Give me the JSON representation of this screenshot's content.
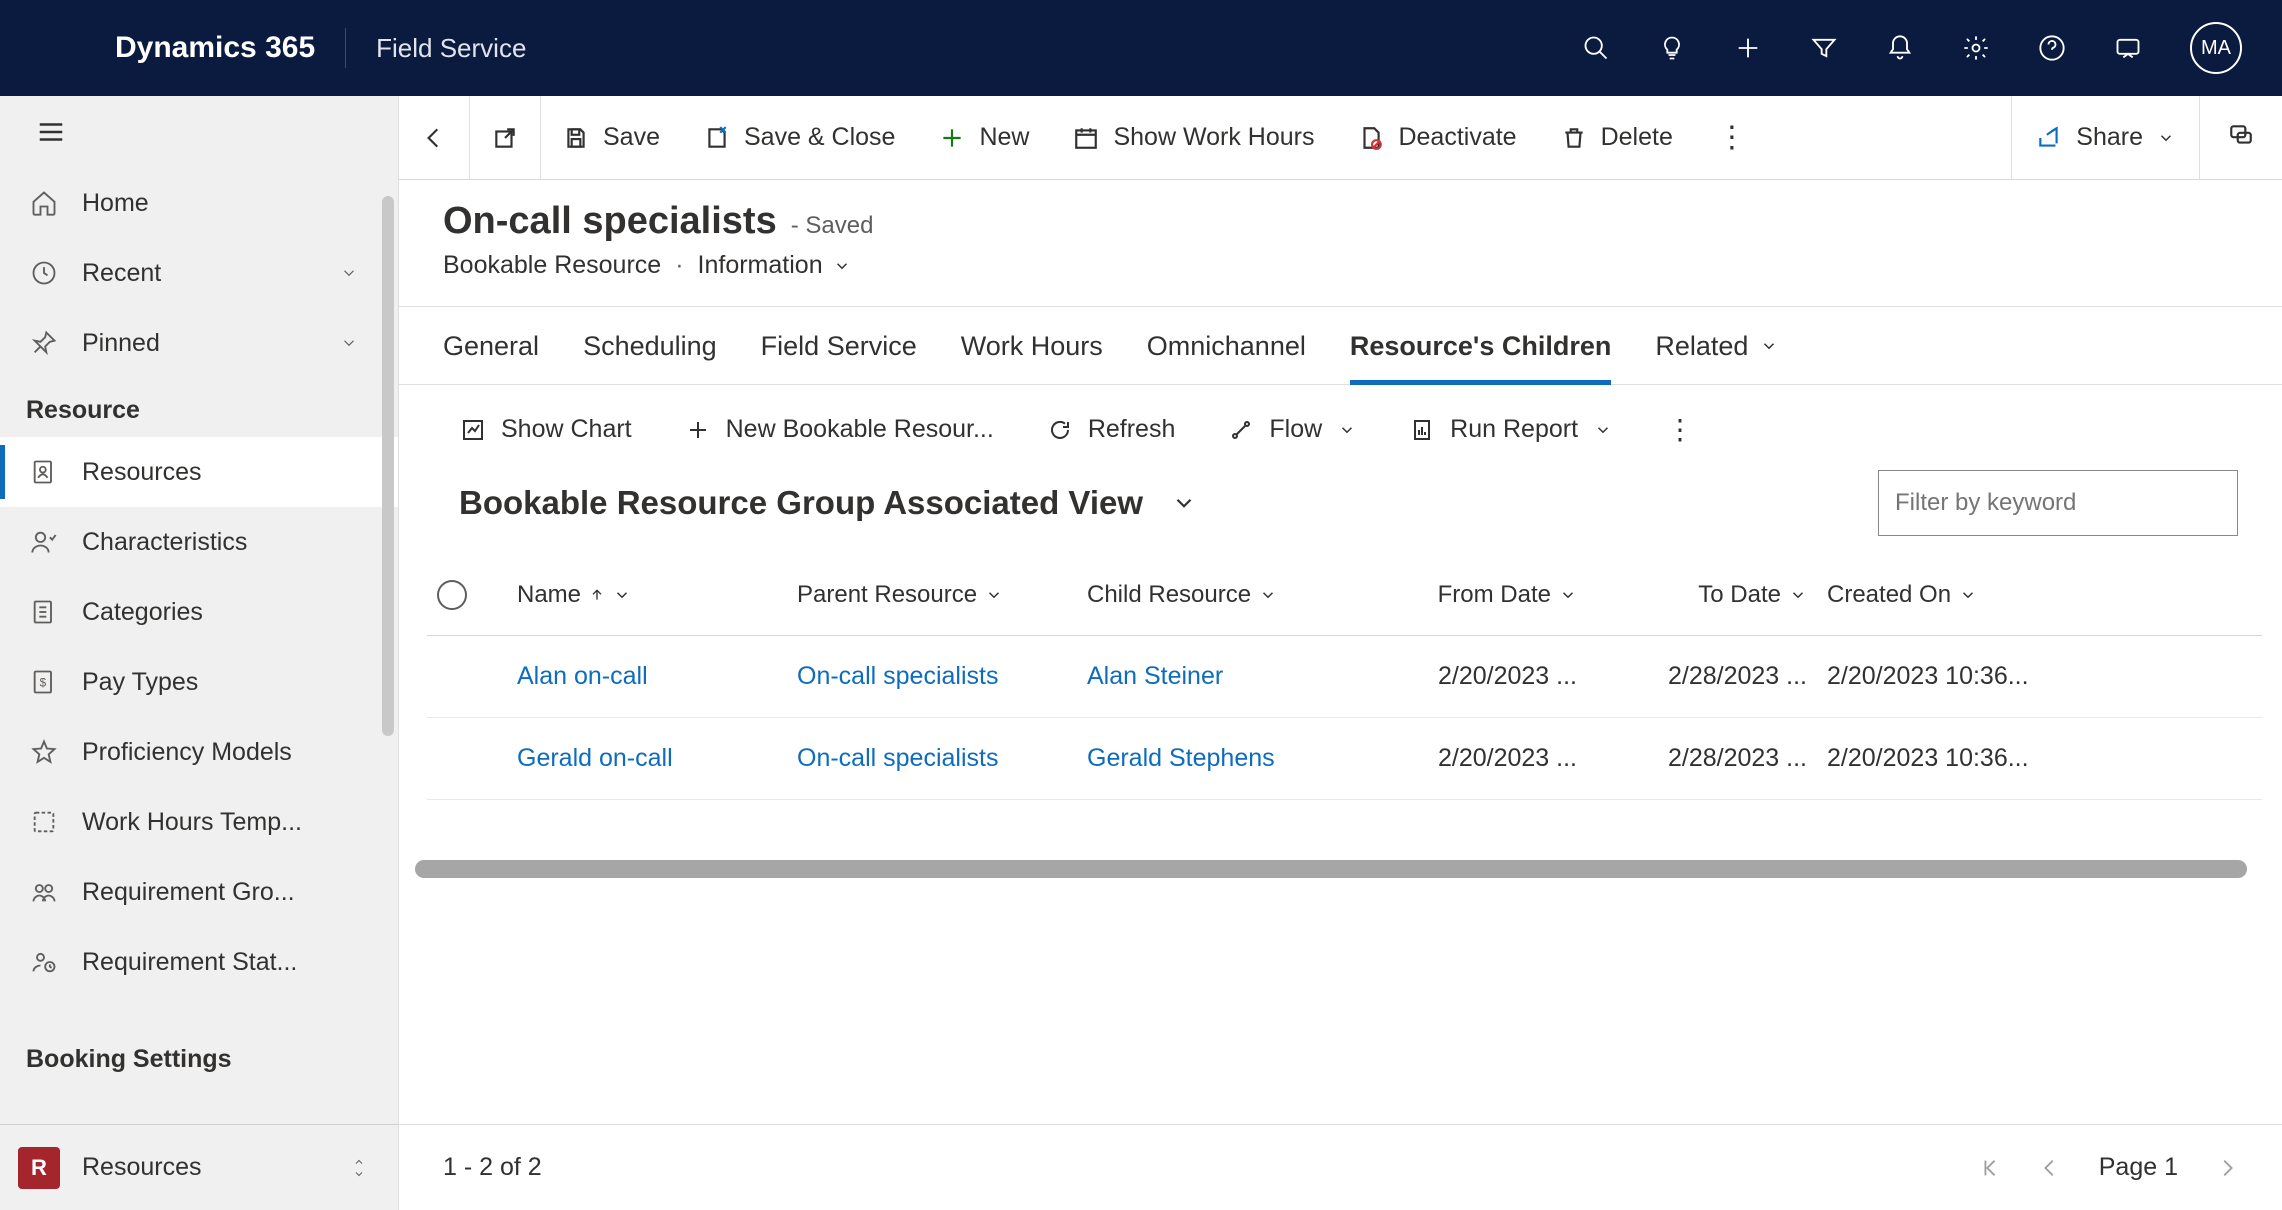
{
  "topbar": {
    "brand": "Dynamics 365",
    "app": "Field Service",
    "avatar": "MA"
  },
  "sidebar": {
    "home": "Home",
    "recent": "Recent",
    "pinned": "Pinned",
    "section1": "Resource",
    "items": [
      "Resources",
      "Characteristics",
      "Categories",
      "Pay Types",
      "Proficiency Models",
      "Work Hours Temp...",
      "Requirement Gro...",
      "Requirement Stat..."
    ],
    "section2": "Booking Settings",
    "footer": {
      "badge": "R",
      "label": "Resources"
    }
  },
  "commands": {
    "save": "Save",
    "saveclose": "Save & Close",
    "new": "New",
    "workhours": "Show Work Hours",
    "deactivate": "Deactivate",
    "delete": "Delete",
    "share": "Share"
  },
  "record": {
    "title": "On-call specialists",
    "status": "- Saved",
    "entity": "Bookable Resource",
    "form": "Information"
  },
  "tabs": [
    "General",
    "Scheduling",
    "Field Service",
    "Work Hours",
    "Omnichannel",
    "Resource's Children",
    "Related"
  ],
  "subcmd": {
    "showchart": "Show Chart",
    "newchild": "New Bookable Resour...",
    "refresh": "Refresh",
    "flow": "Flow",
    "runreport": "Run Report"
  },
  "view": {
    "title": "Bookable Resource Group Associated View",
    "filter_placeholder": "Filter by keyword"
  },
  "columns": [
    "Name",
    "Parent Resource",
    "Child Resource",
    "From Date",
    "To Date",
    "Created On"
  ],
  "rows": [
    {
      "name": "Alan on-call",
      "parent": "On-call specialists",
      "child": "Alan Steiner",
      "from": "2/20/2023 ...",
      "to": "2/28/2023 ...",
      "created": "2/20/2023 10:36..."
    },
    {
      "name": "Gerald on-call",
      "parent": "On-call specialists",
      "child": "Gerald Stephens",
      "from": "2/20/2023 ...",
      "to": "2/28/2023 ...",
      "created": "2/20/2023 10:36..."
    }
  ],
  "paging": {
    "count": "1 - 2 of 2",
    "page": "Page 1"
  }
}
